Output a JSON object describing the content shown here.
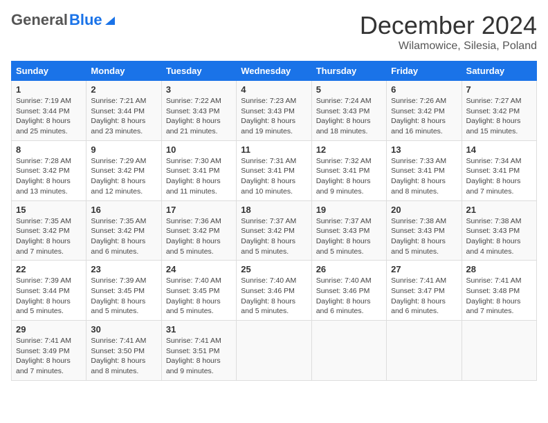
{
  "header": {
    "logo_general": "General",
    "logo_blue": "Blue",
    "month_title": "December 2024",
    "location": "Wilamowice, Silesia, Poland"
  },
  "days_of_week": [
    "Sunday",
    "Monday",
    "Tuesday",
    "Wednesday",
    "Thursday",
    "Friday",
    "Saturday"
  ],
  "weeks": [
    [
      {
        "day": "1",
        "sunrise": "7:19 AM",
        "sunset": "3:44 PM",
        "daylight": "8 hours and 25 minutes."
      },
      {
        "day": "2",
        "sunrise": "7:21 AM",
        "sunset": "3:44 PM",
        "daylight": "8 hours and 23 minutes."
      },
      {
        "day": "3",
        "sunrise": "7:22 AM",
        "sunset": "3:43 PM",
        "daylight": "8 hours and 21 minutes."
      },
      {
        "day": "4",
        "sunrise": "7:23 AM",
        "sunset": "3:43 PM",
        "daylight": "8 hours and 19 minutes."
      },
      {
        "day": "5",
        "sunrise": "7:24 AM",
        "sunset": "3:43 PM",
        "daylight": "8 hours and 18 minutes."
      },
      {
        "day": "6",
        "sunrise": "7:26 AM",
        "sunset": "3:42 PM",
        "daylight": "8 hours and 16 minutes."
      },
      {
        "day": "7",
        "sunrise": "7:27 AM",
        "sunset": "3:42 PM",
        "daylight": "8 hours and 15 minutes."
      }
    ],
    [
      {
        "day": "8",
        "sunrise": "7:28 AM",
        "sunset": "3:42 PM",
        "daylight": "8 hours and 13 minutes."
      },
      {
        "day": "9",
        "sunrise": "7:29 AM",
        "sunset": "3:42 PM",
        "daylight": "8 hours and 12 minutes."
      },
      {
        "day": "10",
        "sunrise": "7:30 AM",
        "sunset": "3:41 PM",
        "daylight": "8 hours and 11 minutes."
      },
      {
        "day": "11",
        "sunrise": "7:31 AM",
        "sunset": "3:41 PM",
        "daylight": "8 hours and 10 minutes."
      },
      {
        "day": "12",
        "sunrise": "7:32 AM",
        "sunset": "3:41 PM",
        "daylight": "8 hours and 9 minutes."
      },
      {
        "day": "13",
        "sunrise": "7:33 AM",
        "sunset": "3:41 PM",
        "daylight": "8 hours and 8 minutes."
      },
      {
        "day": "14",
        "sunrise": "7:34 AM",
        "sunset": "3:41 PM",
        "daylight": "8 hours and 7 minutes."
      }
    ],
    [
      {
        "day": "15",
        "sunrise": "7:35 AM",
        "sunset": "3:42 PM",
        "daylight": "8 hours and 7 minutes."
      },
      {
        "day": "16",
        "sunrise": "7:35 AM",
        "sunset": "3:42 PM",
        "daylight": "8 hours and 6 minutes."
      },
      {
        "day": "17",
        "sunrise": "7:36 AM",
        "sunset": "3:42 PM",
        "daylight": "8 hours and 5 minutes."
      },
      {
        "day": "18",
        "sunrise": "7:37 AM",
        "sunset": "3:42 PM",
        "daylight": "8 hours and 5 minutes."
      },
      {
        "day": "19",
        "sunrise": "7:37 AM",
        "sunset": "3:43 PM",
        "daylight": "8 hours and 5 minutes."
      },
      {
        "day": "20",
        "sunrise": "7:38 AM",
        "sunset": "3:43 PM",
        "daylight": "8 hours and 5 minutes."
      },
      {
        "day": "21",
        "sunrise": "7:38 AM",
        "sunset": "3:43 PM",
        "daylight": "8 hours and 4 minutes."
      }
    ],
    [
      {
        "day": "22",
        "sunrise": "7:39 AM",
        "sunset": "3:44 PM",
        "daylight": "8 hours and 5 minutes."
      },
      {
        "day": "23",
        "sunrise": "7:39 AM",
        "sunset": "3:45 PM",
        "daylight": "8 hours and 5 minutes."
      },
      {
        "day": "24",
        "sunrise": "7:40 AM",
        "sunset": "3:45 PM",
        "daylight": "8 hours and 5 minutes."
      },
      {
        "day": "25",
        "sunrise": "7:40 AM",
        "sunset": "3:46 PM",
        "daylight": "8 hours and 5 minutes."
      },
      {
        "day": "26",
        "sunrise": "7:40 AM",
        "sunset": "3:46 PM",
        "daylight": "8 hours and 6 minutes."
      },
      {
        "day": "27",
        "sunrise": "7:41 AM",
        "sunset": "3:47 PM",
        "daylight": "8 hours and 6 minutes."
      },
      {
        "day": "28",
        "sunrise": "7:41 AM",
        "sunset": "3:48 PM",
        "daylight": "8 hours and 7 minutes."
      }
    ],
    [
      {
        "day": "29",
        "sunrise": "7:41 AM",
        "sunset": "3:49 PM",
        "daylight": "8 hours and 7 minutes."
      },
      {
        "day": "30",
        "sunrise": "7:41 AM",
        "sunset": "3:50 PM",
        "daylight": "8 hours and 8 minutes."
      },
      {
        "day": "31",
        "sunrise": "7:41 AM",
        "sunset": "3:51 PM",
        "daylight": "8 hours and 9 minutes."
      },
      null,
      null,
      null,
      null
    ]
  ]
}
